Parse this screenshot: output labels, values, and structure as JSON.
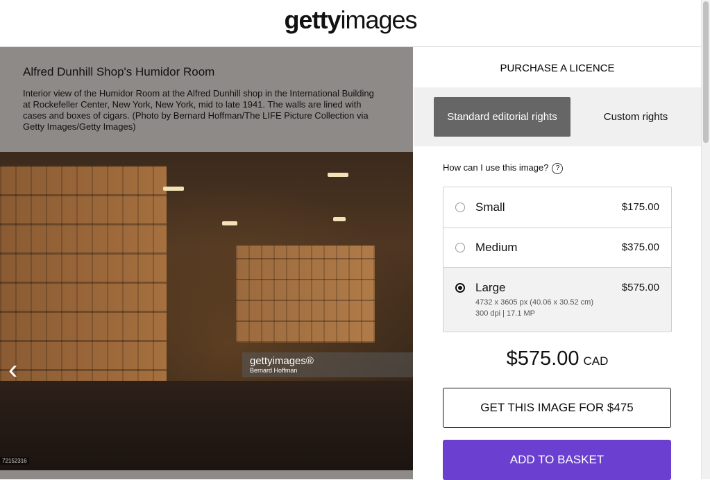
{
  "header": {
    "logo_bold": "getty",
    "logo_light": "images"
  },
  "image": {
    "title": "Alfred Dunhill Shop's Humidor Room",
    "description": "Interior view of the Humidor Room at the Alfred Dunhill shop in the International Building at Rockefeller Center, New York, New York, mid to late 1941. The walls are lined with cases and boxes of cigars. (Photo by Bernard Hoffman/The LIFE Picture Collection via Getty Images/Getty Images)",
    "watermark_logo": "gettyimages®",
    "watermark_credit": "Bernard Hoffman",
    "id_text": "72152316",
    "prev_icon": "chevron-left-icon"
  },
  "purchase": {
    "heading": "PURCHASE A LICENCE",
    "rights_standard": "Standard editorial rights",
    "rights_custom": "Custom rights",
    "usage_question": "How can I use this image?",
    "help_icon": "?",
    "sizes": [
      {
        "name": "Small",
        "price": "$175.00",
        "selected": false
      },
      {
        "name": "Medium",
        "price": "$375.00",
        "selected": false
      },
      {
        "name": "Large",
        "price": "$575.00",
        "selected": true,
        "detail_1": "4732 x 3605 px (40.06 x 30.52 cm)",
        "detail_2": "300 dpi | 17.1 MP"
      }
    ],
    "total_amount": "$575.00",
    "total_currency": "CAD",
    "get_image_label": "GET THIS IMAGE FOR $475",
    "add_to_basket_label": "ADD TO BASKET",
    "accent_color": "#6b3fd0"
  }
}
